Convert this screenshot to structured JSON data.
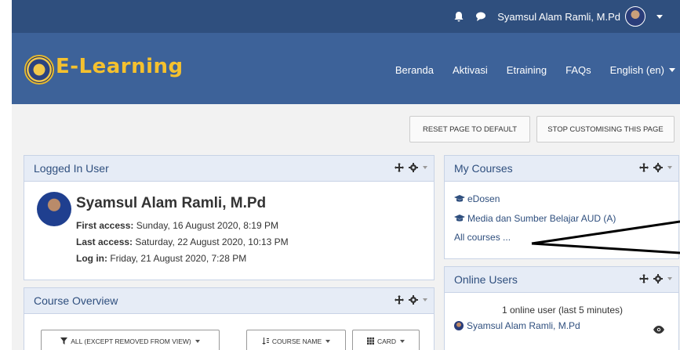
{
  "topbar": {
    "user_name": "Syamsul Alam Ramli, M.Pd",
    "icons": [
      "bell-icon",
      "chat-icon",
      "caret-down-icon"
    ]
  },
  "navbar": {
    "brand": "E-Learning",
    "menu": [
      "Beranda",
      "Aktivasi",
      "Etraining",
      "FAQs"
    ],
    "language": "English (en)"
  },
  "actions": {
    "reset": "RESET PAGE TO DEFAULT",
    "stop": "STOP CUSTOMISING THIS PAGE"
  },
  "logged_in": {
    "title": "Logged In User",
    "name": "Syamsul Alam Ramli, M.Pd",
    "first_label": "First access:",
    "first_value": " Sunday, 16 August 2020, 8:19 PM",
    "last_label": "Last access:",
    "last_value": " Saturday, 22 August 2020, 10:13 PM",
    "login_label": "Log in:",
    "login_value": " Friday, 21 August 2020, 7:28 PM"
  },
  "course_overview": {
    "title": "Course Overview",
    "filter": "ALL (EXCEPT REMOVED FROM VIEW)",
    "sort": "COURSE NAME",
    "view": "CARD"
  },
  "my_courses": {
    "title": "My Courses",
    "items": [
      "eDosen",
      "Media dan Sumber Belajar AUD (A)"
    ],
    "all_link": "All courses ..."
  },
  "online_users": {
    "title": "Online Users",
    "summary": "1 online user (last 5 minutes)",
    "user": "Syamsul Alam Ramli, M.Pd"
  },
  "colors": {
    "topbar": "#2f4f7e",
    "navbar": "#3d6299",
    "brand": "#f5c12e",
    "block_header": "#e6ecf6"
  }
}
